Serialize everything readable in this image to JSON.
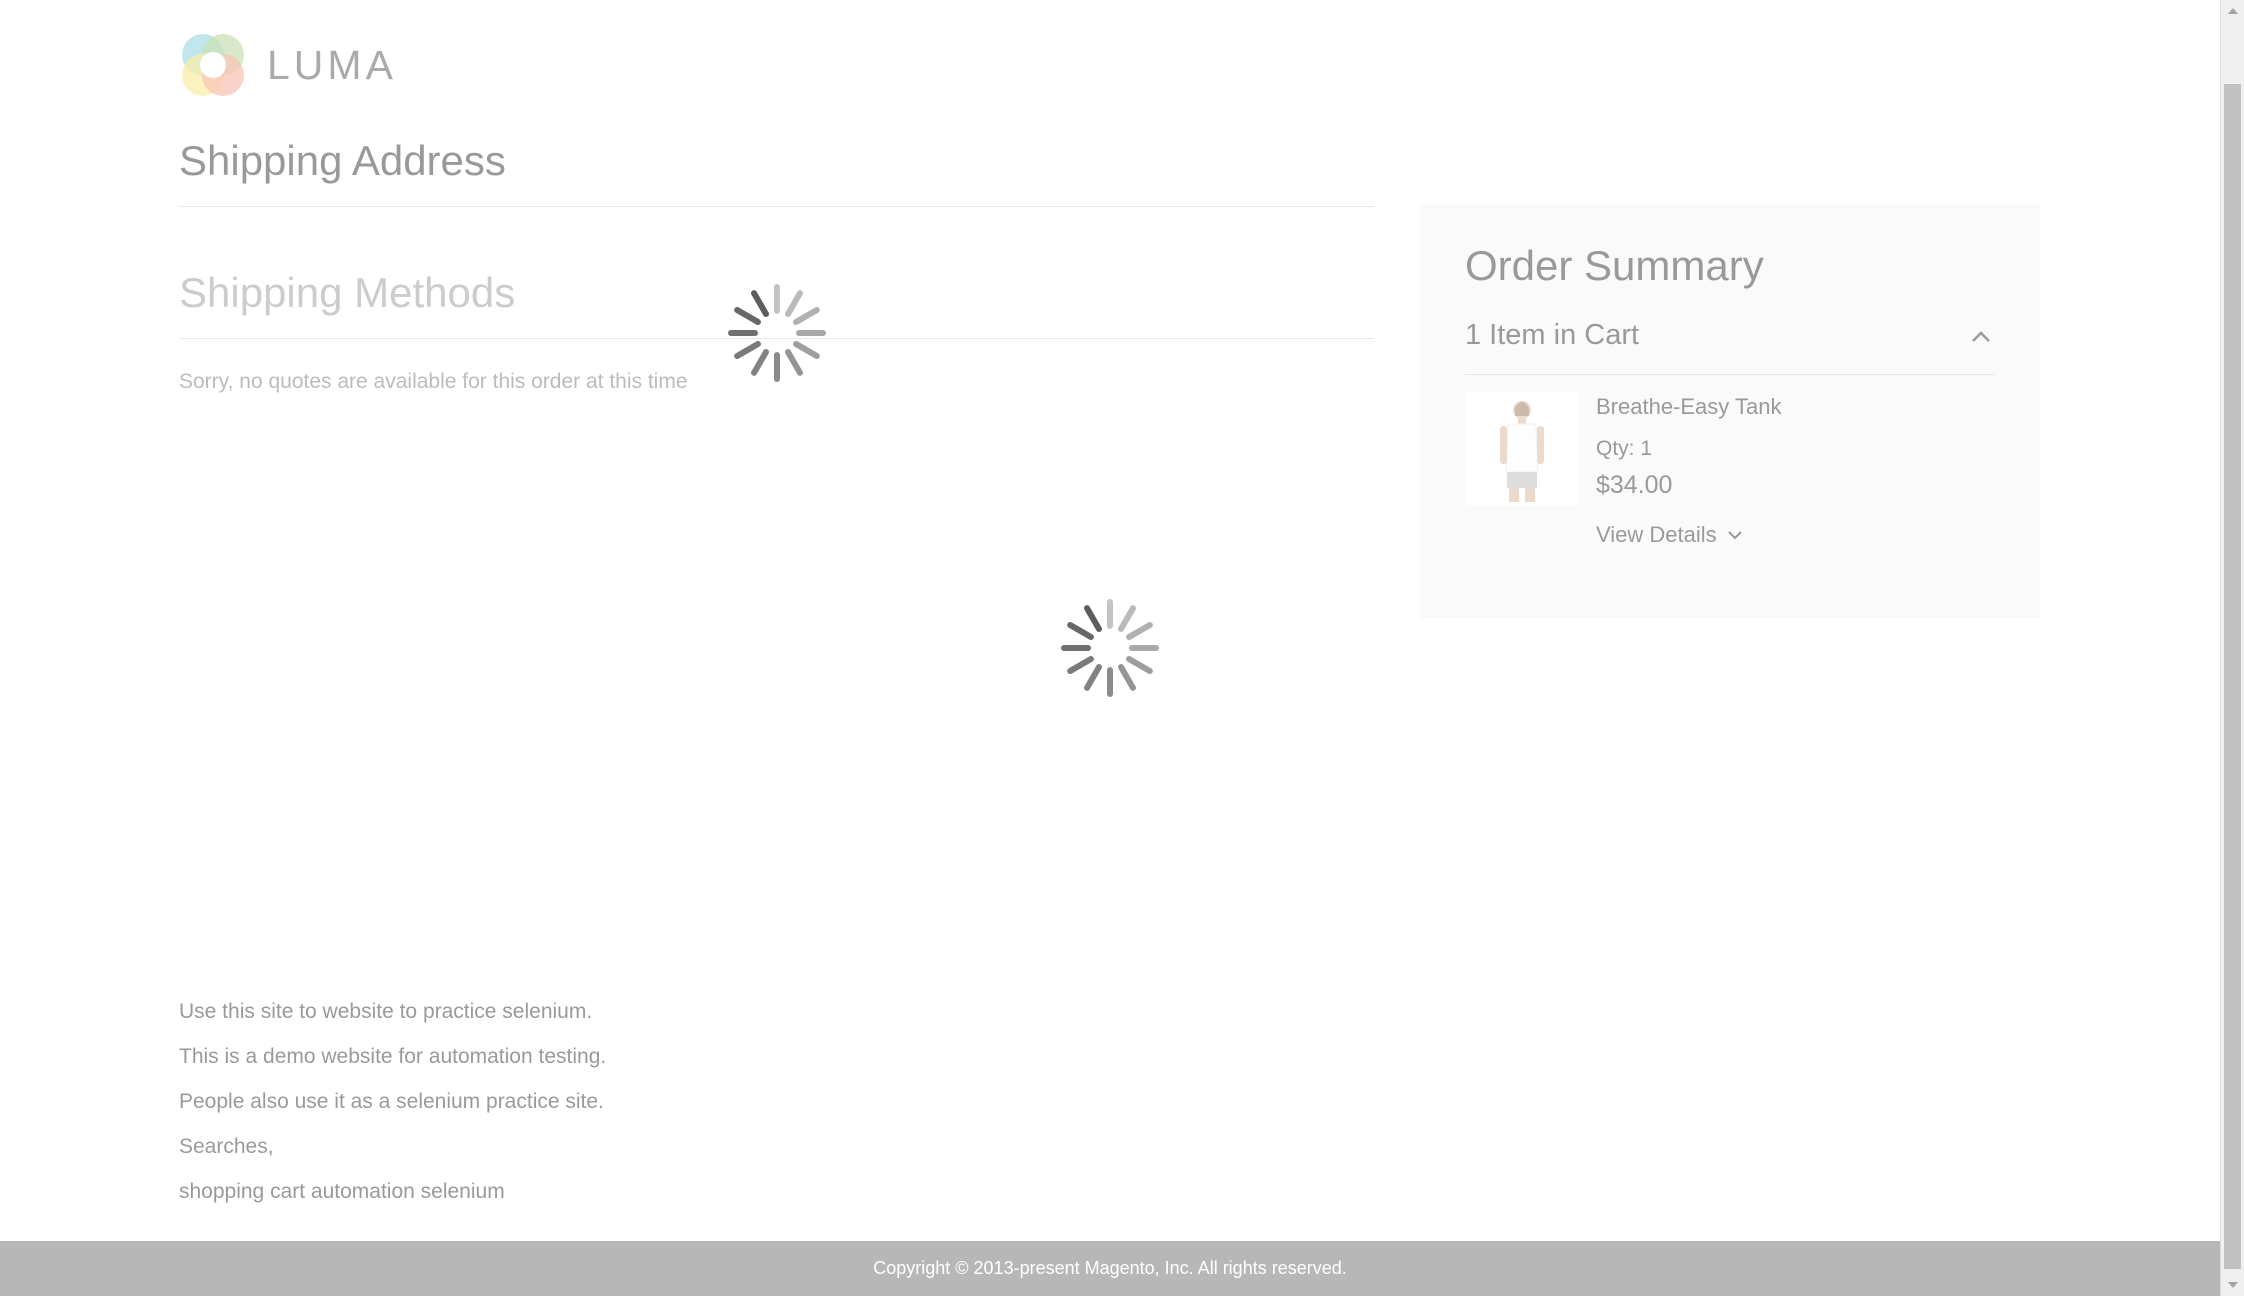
{
  "brand": {
    "logo_text": "LUMA",
    "colors": {
      "teal": "#6cc3d3",
      "green": "#96c36e",
      "yellow": "#f6dc55",
      "orange": "#f0896b"
    }
  },
  "checkout": {
    "shipping_address_title": "Shipping Address",
    "shipping_methods_title": "Shipping Methods",
    "no_quotes_message": "Sorry, no quotes are available for this order at this time"
  },
  "summary": {
    "title": "Order Summary",
    "items_count_label": "1 Item in Cart",
    "toggle_icon": "chevron-up-icon",
    "item": {
      "name": "Breathe-Easy Tank",
      "qty_label": "Qty: 1",
      "price": "$34.00",
      "view_details_label": "View Details"
    }
  },
  "footer": {
    "lines": [
      "Use this site to website to practice selenium.",
      "This is a demo website for automation testing.",
      "People also use it as a selenium practice site.",
      "Searches,",
      "shopping cart automation selenium"
    ],
    "copyright": "Copyright © 2013-present Magento, Inc. All rights reserved."
  },
  "state": {
    "loading": true,
    "spinner_icon": "loading-spinner-icon"
  }
}
